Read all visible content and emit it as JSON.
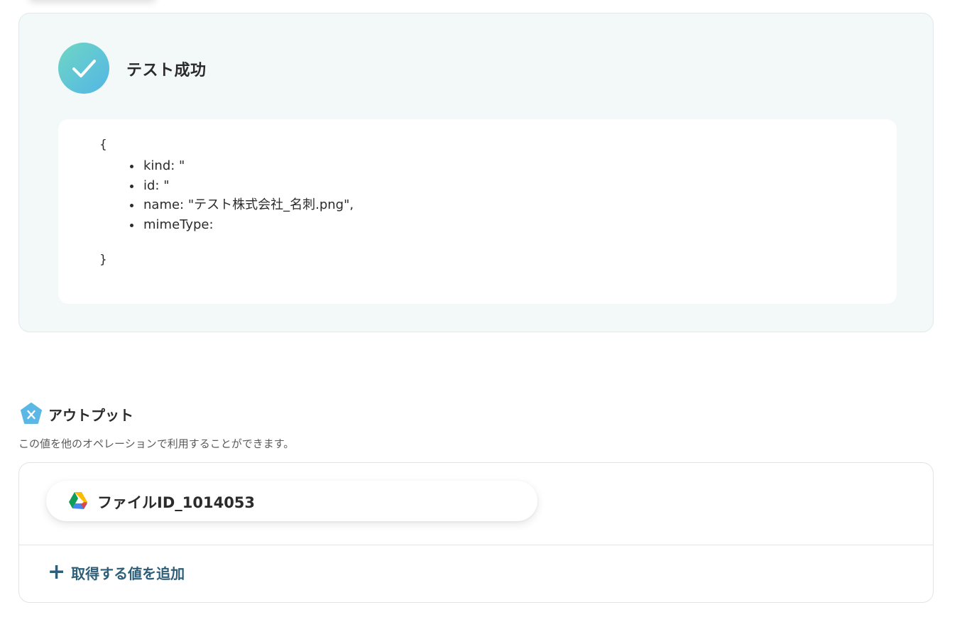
{
  "test_result": {
    "title": "テスト成功",
    "json_open": "{",
    "json_close": "}",
    "fields": [
      "kind: \"",
      "id: \"",
      "name: \"テスト株式会社_名刺.png\",",
      "mimeType:"
    ]
  },
  "output": {
    "title": "アウトプット",
    "description": "この値を他のオペレーションで利用することができます。",
    "values": [
      {
        "label": "ファイルID_1014053",
        "icon": "google-drive-icon"
      }
    ],
    "add_button_label": "取得する値を追加",
    "add_button_icon": "plus-icon"
  },
  "colors": {
    "panel_bg": "#f3f8f8",
    "success_gradient_start": "#6fd6c4",
    "success_gradient_end": "#52b6e6",
    "accent_text": "#2f5f78",
    "output_icon": "#5bb8e6"
  }
}
